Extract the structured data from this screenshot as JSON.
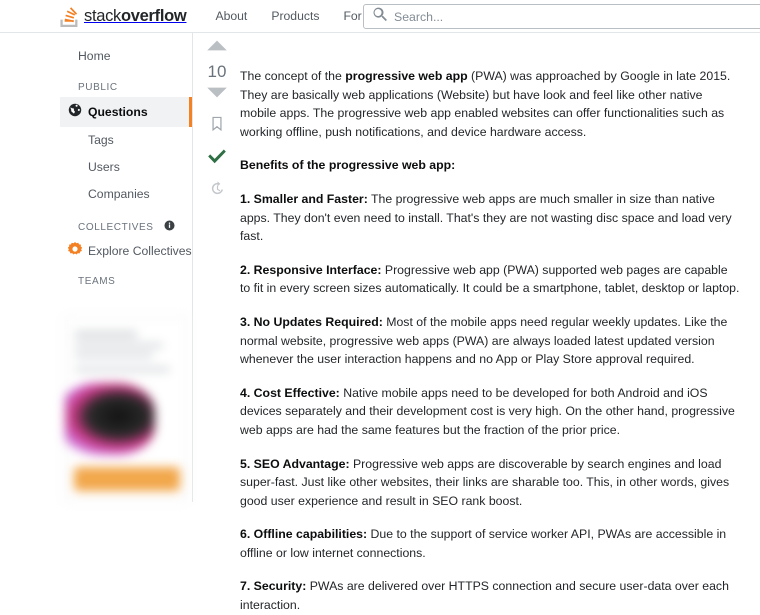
{
  "header": {
    "logo": {
      "light": "stack",
      "bold": "overflow",
      "icon": "stackoverflow-logo-icon"
    },
    "nav": [
      {
        "label": "About",
        "name": "nav-link-about"
      },
      {
        "label": "Products",
        "name": "nav-link-products"
      },
      {
        "label": "For Teams",
        "name": "nav-link-for-teams"
      }
    ],
    "search": {
      "placeholder": "Search...",
      "value": "",
      "icon": "search-icon"
    }
  },
  "sidebar": {
    "home": "Home",
    "public_label": "PUBLIC",
    "public_items": [
      {
        "label": "Questions",
        "active": true,
        "icon": "globe-icon"
      },
      {
        "label": "Tags",
        "active": false
      },
      {
        "label": "Users",
        "active": false
      },
      {
        "label": "Companies",
        "active": false
      }
    ],
    "collectives_label": "COLLECTIVES",
    "collectives_info_icon": "info-icon",
    "explore_collectives": "Explore Collectives",
    "explore_collectives_icon": "collectives-gear-icon",
    "teams_label": "TEAMS"
  },
  "vote": {
    "up_icon": "vote-up-arrow-icon",
    "down_icon": "vote-down-arrow-icon",
    "count": "10",
    "bookmark_icon": "bookmark-icon",
    "accepted_icon": "accepted-answer-check-icon",
    "history_icon": "edit-history-clock-icon"
  },
  "answer": {
    "intro_a": "The concept of the ",
    "intro_b": "progressive web app",
    "intro_c": " (PWA) was approached by Google in late 2015. They are basically web applications (Website) but have look and feel like other native mobile apps. The progressive web app enabled websites can offer functionalities such as working offline, push notifications, and device hardware access.",
    "benefits_heading": "Benefits of the progressive web app:",
    "benefits": [
      {
        "title": "1. Smaller and Faster:",
        "text": " The progressive web apps are much smaller in size than native apps. They don't even need to install. That's they are not wasting disc space and load very fast."
      },
      {
        "title": "2. Responsive Interface:",
        "text": " Progressive web app (PWA) supported web pages are capable to fit in every screen sizes automatically. It could be a smartphone, tablet, desktop or laptop."
      },
      {
        "title": "3. No Updates Required:",
        "text": " Most of the mobile apps need regular weekly updates. Like the normal website, progressive web apps (PWA) are always loaded latest updated version whenever the user interaction happens and no App or Play Store approval required."
      },
      {
        "title": "4. Cost Effective:",
        "text": " Native mobile apps need to be developed for both Android and iOS devices separately and their development cost is very high. On the other hand, progressive web apps are had the same features but the fraction of the prior price."
      },
      {
        "title": "5. SEO Advantage:",
        "text": " Progressive web apps are discoverable by search engines and load super-fast. Just like other websites, their links are sharable too. This, in other words, gives good user experience and result in SEO rank boost."
      },
      {
        "title": "6. Offline capabilities:",
        "text": " Due to the support of service worker API, PWAs are accessible in offline or low internet connections."
      },
      {
        "title": "7. Security:",
        "text": " PWAs are delivered over HTTPS connection and secure user-data over each interaction."
      }
    ]
  },
  "colors": {
    "brand_orange": "#f48225",
    "accepted_green": "#2f6f44",
    "text": "#232629",
    "muted": "#6a737c",
    "border": "#e3e6e8"
  }
}
